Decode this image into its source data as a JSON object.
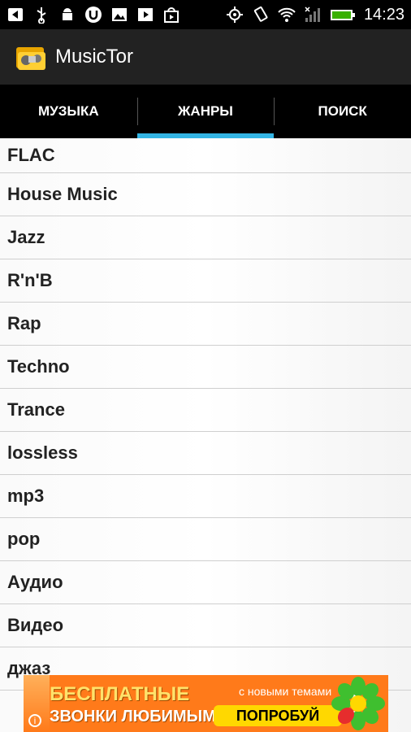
{
  "status_bar": {
    "time": "14:23",
    "icons_left": [
      "back-icon",
      "usb-icon",
      "android-icon",
      "torrent-icon",
      "image-icon",
      "play-icon",
      "play-store-icon"
    ],
    "icons_right": [
      "gps-icon",
      "rotate-icon",
      "wifi-icon",
      "signal-icon",
      "battery-icon"
    ]
  },
  "action_bar": {
    "title": "MusicTor"
  },
  "tabs": [
    {
      "label": "МУЗЫКА"
    },
    {
      "label": "ЖАНРЫ"
    },
    {
      "label": "ПОИСК"
    }
  ],
  "active_tab": 1,
  "genres": [
    "FLAC",
    "House Music",
    "Jazz",
    "R'n'B",
    "Rap",
    "Techno",
    "Trance",
    "lossless",
    "mp3",
    "pop",
    "Аудио",
    "Видео",
    "джаз"
  ],
  "ad": {
    "line1": "БЕСПЛАТНЫЕ",
    "line2": "ЗВОНКИ ЛЮБИМЫМ",
    "small_text": "с новыми темами",
    "button": "ПОПРОБУЙ",
    "info_symbol": "i"
  },
  "colors": {
    "accent": "#33b5e5",
    "actionbar": "#222222",
    "ad_bg": "#ff7a1a",
    "ad_button": "#ffd800"
  }
}
